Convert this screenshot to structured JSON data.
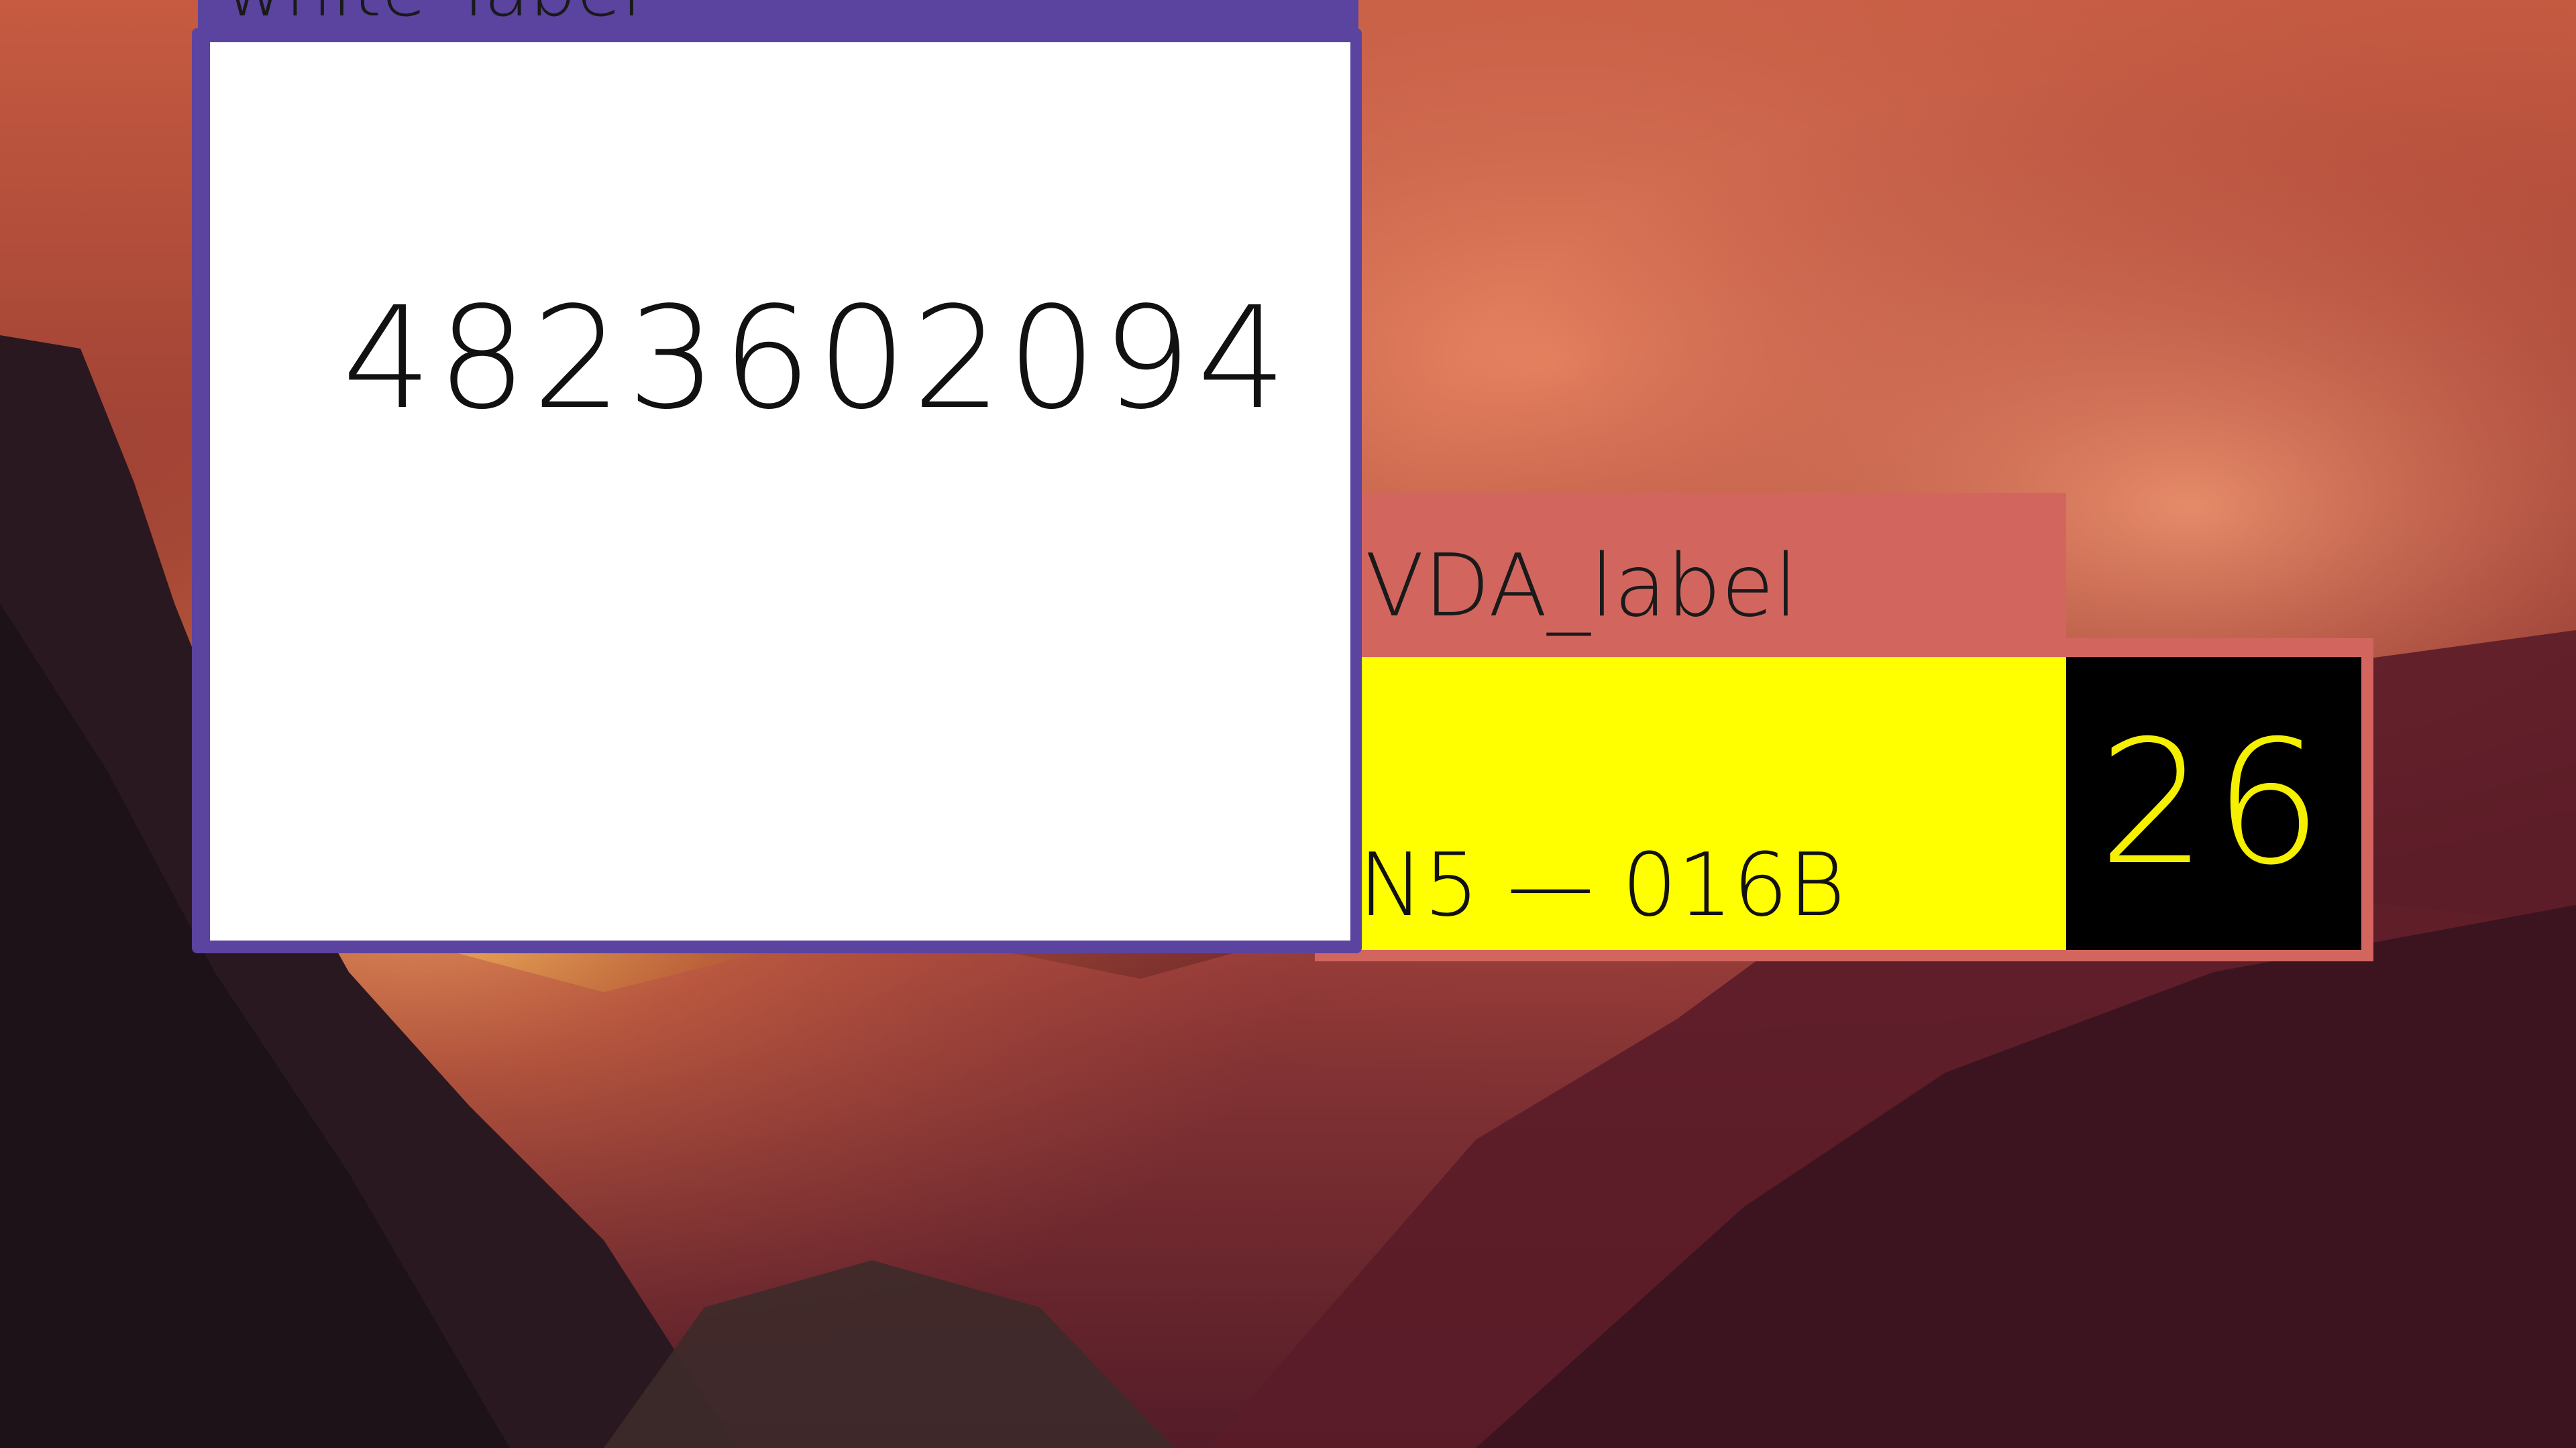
{
  "desktop": {
    "wallpaper": "mountain-valley-sunset"
  },
  "white_label_window": {
    "title": "white_label",
    "value": "4823602094",
    "accent_color": "#5b43a0"
  },
  "vda_label_window": {
    "title": "VDA_label",
    "code": "N5 — 016B",
    "number": "26",
    "accent_color": "#d2665f",
    "panel_color": "#ffff00"
  }
}
